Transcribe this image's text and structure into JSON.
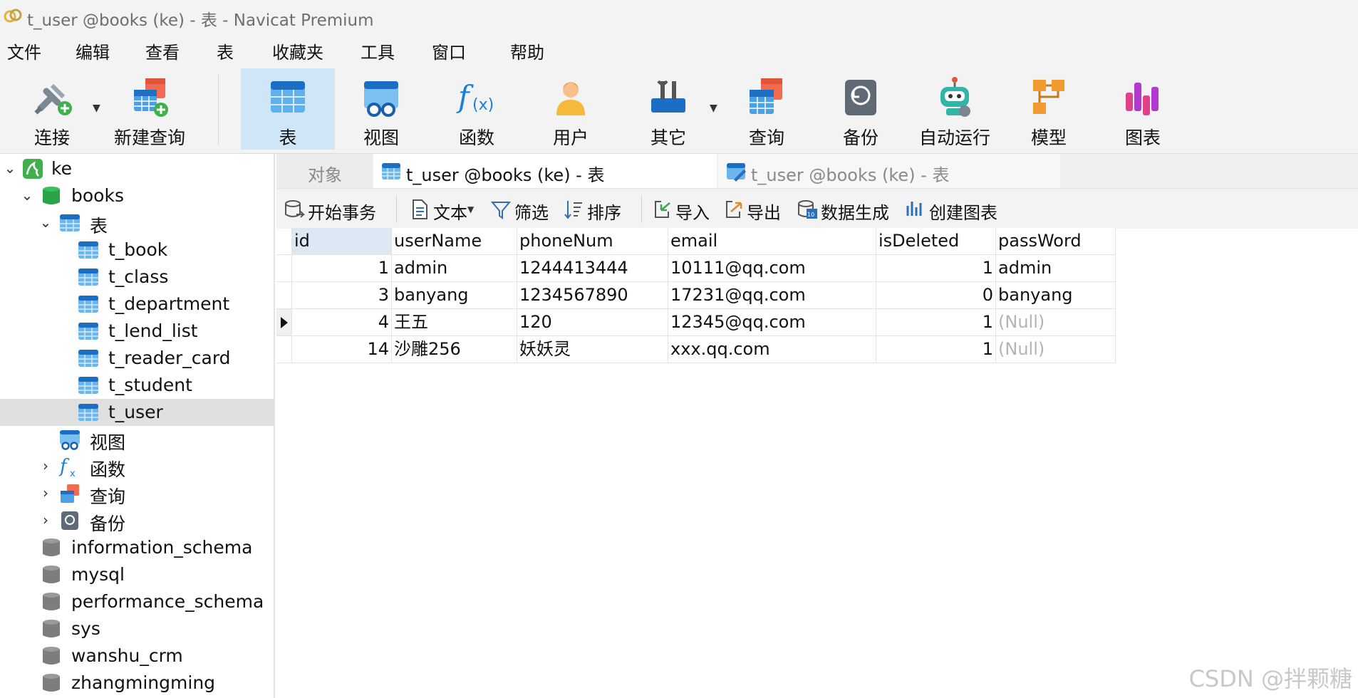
{
  "window": {
    "title": "t_user @books (ke) - 表 - Navicat Premium"
  },
  "menu": [
    "文件",
    "编辑",
    "查看",
    "表",
    "收藏夹",
    "工具",
    "窗口",
    "帮助"
  ],
  "toolbar": {
    "connect": "连接",
    "new_query": "新建查询",
    "table": "表",
    "view": "视图",
    "function": "函数",
    "user": "用户",
    "other": "其它",
    "query": "查询",
    "backup": "备份",
    "automation": "自动运行",
    "model": "模型",
    "chart": "图表"
  },
  "sidebar": {
    "connection": "ke",
    "database": "books",
    "tables_group": "表",
    "tables": [
      "t_book",
      "t_class",
      "t_department",
      "t_lend_list",
      "t_reader_card",
      "t_student",
      "t_user"
    ],
    "selected_table": "t_user",
    "groups": {
      "views": "视图",
      "functions": "函数",
      "queries": "查询",
      "backups": "备份"
    },
    "other_databases": [
      "information_schema",
      "mysql",
      "performance_schema",
      "sys",
      "wanshu_crm",
      "zhangmingming"
    ]
  },
  "tabs": {
    "objects": "对象",
    "tab1": "t_user @books (ke) - 表",
    "tab2": "t_user @books (ke) - 表"
  },
  "subtoolbar": {
    "begin_transaction": "开始事务",
    "text": "文本",
    "filter": "筛选",
    "sort": "排序",
    "import": "导入",
    "export": "导出",
    "data_generation": "数据生成",
    "create_chart": "创建图表"
  },
  "grid": {
    "columns": [
      "id",
      "userName",
      "phoneNum",
      "email",
      "isDeleted",
      "passWord"
    ],
    "rows": [
      [
        "1",
        "admin",
        "1244413444",
        "10111@qq.com",
        "1",
        "admin"
      ],
      [
        "3",
        "banyang",
        "1234567890",
        "17231@qq.com",
        "0",
        "banyang"
      ],
      [
        "4",
        "王五",
        "120",
        "12345@qq.com",
        "1",
        "(Null)"
      ],
      [
        "14",
        "沙雕256",
        "妖妖灵",
        "xxx.qq.com",
        "1",
        "(Null)"
      ]
    ],
    "current_row": 3
  },
  "watermark": "CSDN @拌颗糖"
}
